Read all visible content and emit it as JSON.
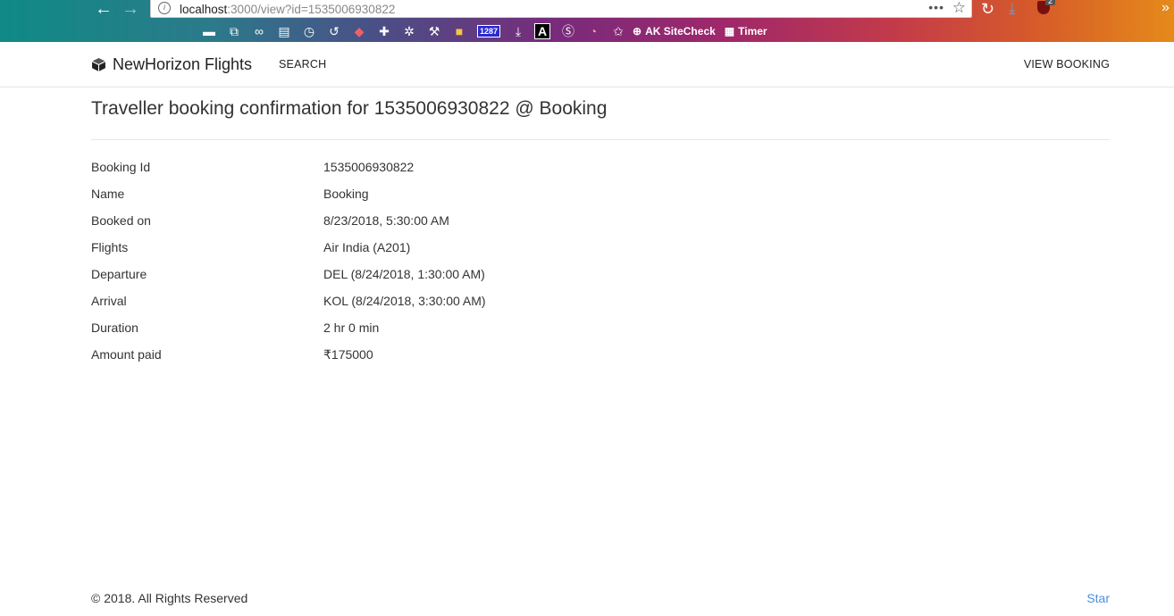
{
  "browser": {
    "url_host": "localhost",
    "url_rest": ":3000/view?id=1535006930822",
    "more_label": "•••",
    "ublock_count": "2",
    "bookmark_badge": "1287",
    "bookmark_a": "A",
    "sitecheck_label": "AK SiteCheck",
    "timer_label": "Timer"
  },
  "navbar": {
    "brand": "NewHorizon Flights",
    "search_label": "SEARCH",
    "view_booking_label": "VIEW BOOKING"
  },
  "page": {
    "title": "Traveller booking confirmation for 1535006930822 @ Booking"
  },
  "details": [
    {
      "label": "Booking Id",
      "value": "1535006930822"
    },
    {
      "label": "Name",
      "value": "Booking"
    },
    {
      "label": "Booked on",
      "value": "8/23/2018, 5:30:00 AM"
    },
    {
      "label": "Flights",
      "value": "Air India (A201)"
    },
    {
      "label": "Departure",
      "value": "DEL (8/24/2018, 1:30:00 AM)"
    },
    {
      "label": "Arrival",
      "value": "KOL (8/24/2018, 3:30:00 AM)"
    },
    {
      "label": "Duration",
      "value": "2 hr 0 min"
    },
    {
      "label": "Amount paid",
      "value": "₹175000"
    }
  ],
  "footer": {
    "copyright": "© 2018. All Rights Reserved",
    "star_label": "Star"
  },
  "colors": {
    "link": "#4a90d9",
    "text": "#333333",
    "divider": "#e6e6e6"
  }
}
